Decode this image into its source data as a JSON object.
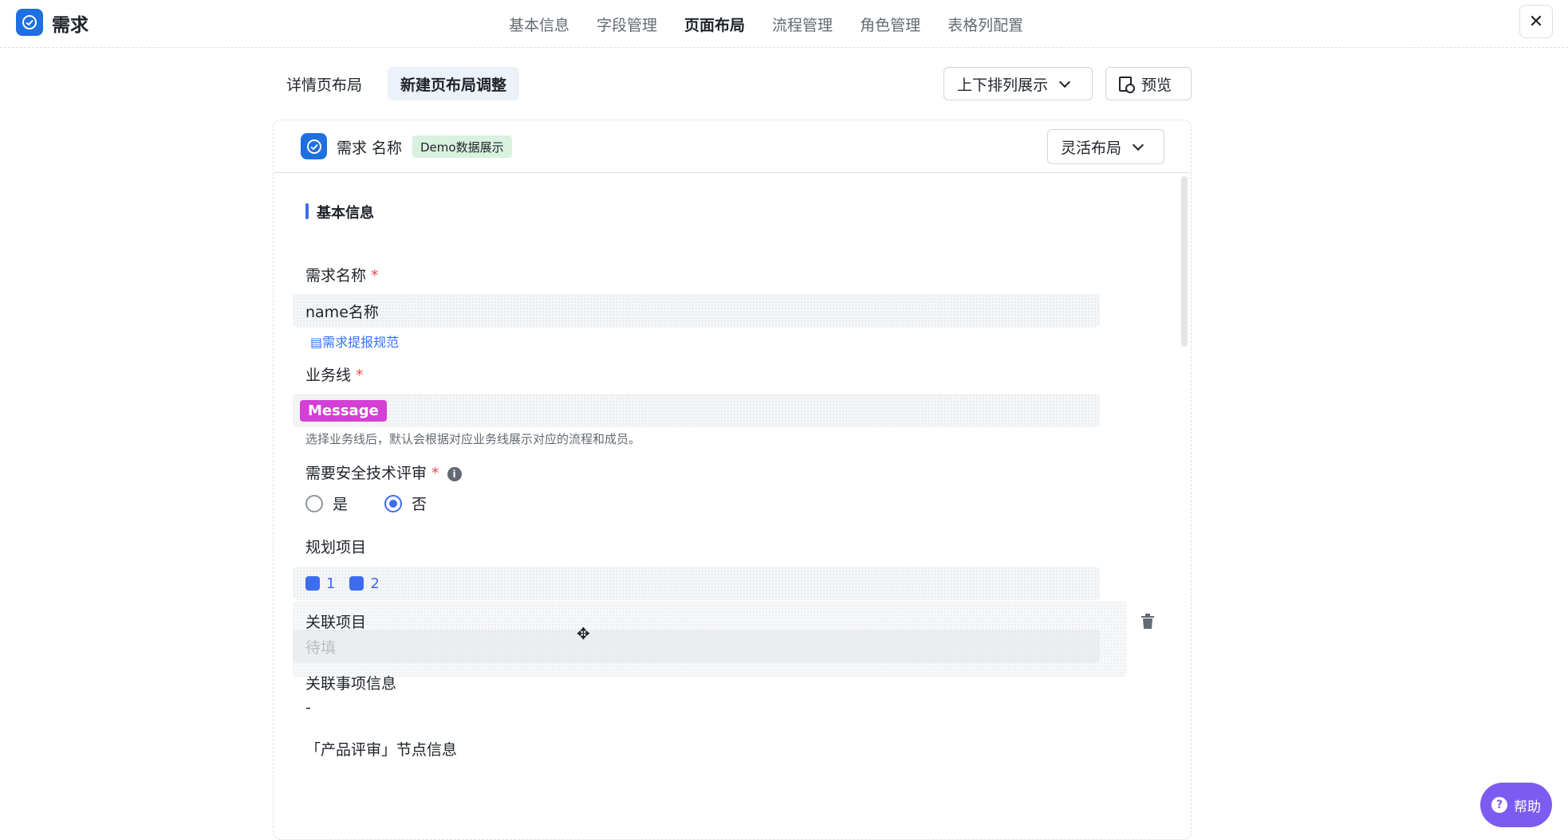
{
  "app": {
    "title": "需求"
  },
  "nav": {
    "tabs": [
      "基本信息",
      "字段管理",
      "页面布局",
      "流程管理",
      "角色管理",
      "表格列配置"
    ],
    "active_index": 2
  },
  "subnav": {
    "tabs": [
      "详情页布局",
      "新建页布局调整"
    ],
    "active_index": 1
  },
  "toolbar": {
    "sort_label": "上下排列展示",
    "preview_label": "预览"
  },
  "card": {
    "title": "需求 名称",
    "badge": "Demo数据展示",
    "layout_label": "灵活布局"
  },
  "section": {
    "title": "基本信息"
  },
  "fields": {
    "name": {
      "label": "需求名称",
      "required_mark": "*",
      "value": "name名称",
      "link": "需求提报规范"
    },
    "business_line": {
      "label": "业务线",
      "required_mark": "*",
      "tag": "Message",
      "hint": "选择业务线后，默认会根据对应业务线展示对应的流程和成员。"
    },
    "security_review": {
      "label": "需要安全技术评审",
      "required_mark": "*",
      "options": [
        "是",
        "否"
      ],
      "selected": "否"
    },
    "planned_projects": {
      "label": "规划项目",
      "items": [
        "1",
        "2"
      ]
    },
    "related_project": {
      "label": "关联项目",
      "placeholder": "待填"
    },
    "related_items": {
      "label": "关联事项信息",
      "value": "-"
    },
    "product_review": {
      "label": "「产品评审」节点信息"
    }
  },
  "help": {
    "label": "帮助"
  },
  "colors": {
    "accent": "#3c6cf0",
    "app_icon": "#1e6fe0",
    "tag_message": "#d43fd6",
    "help_button": "#7c5cf0",
    "badge_bg": "#d9f1df"
  }
}
